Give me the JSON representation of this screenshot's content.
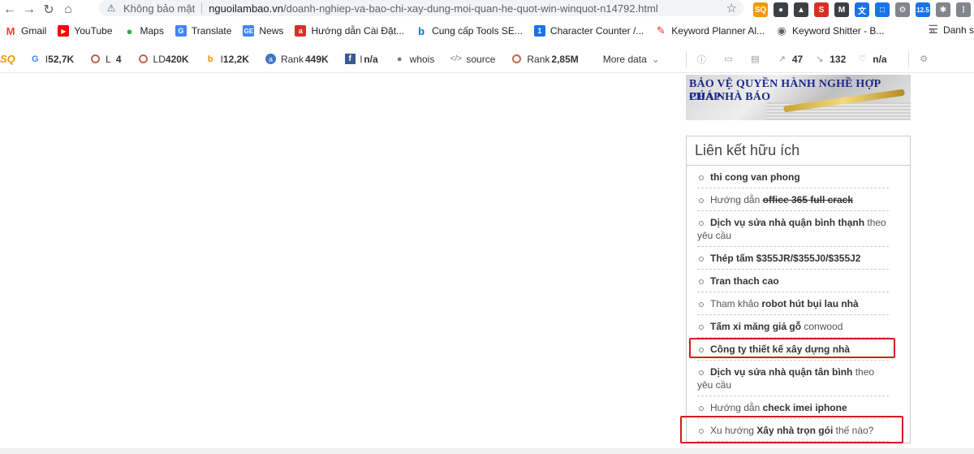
{
  "browser": {
    "security_label": "Không bảo mật",
    "url_domain": "nguoilambao.vn",
    "url_path": "/doanh-nghiep-va-bao-chi-xay-dung-moi-quan-he-quot-win-winquot-n14792.html",
    "extensions_badge": "12.5",
    "reading_list_label": "Danh s"
  },
  "bookmarks": [
    {
      "label": "Gmail",
      "icon": "gmail-icon",
      "color": "#ea4335"
    },
    {
      "label": "YouTube",
      "icon": "youtube-icon",
      "color": "#ff0000"
    },
    {
      "label": "Maps",
      "icon": "maps-icon",
      "color": "#34a853"
    },
    {
      "label": "Translate",
      "icon": "translate-icon",
      "color": "#4285f4"
    },
    {
      "label": "News",
      "icon": "news-icon",
      "color": "#4285f4"
    },
    {
      "label": "Hướng dẫn Cài Đặt...",
      "icon": "a-icon",
      "color": "#d93025"
    },
    {
      "label": "Cung cấp Tools SE...",
      "icon": "bing-icon",
      "color": "#0078d4"
    },
    {
      "label": "Character Counter /...",
      "icon": "one-icon",
      "color": "#1a73e8"
    },
    {
      "label": "Keyword Planner Al...",
      "icon": "keyword-icon",
      "color": "#d93025"
    },
    {
      "label": "Keyword Shitter - B...",
      "icon": "globe-icon",
      "color": "#5f6368"
    }
  ],
  "seo_toolbar": {
    "items": [
      {
        "icon": "google-icon",
        "prefix": "I",
        "value": "52,7K"
      },
      {
        "icon": "circle-icon",
        "prefix": "L",
        "value": "4"
      },
      {
        "icon": "circle-icon",
        "prefix": "LD",
        "value": "420K"
      },
      {
        "icon": "bing-icon",
        "prefix": "I",
        "value": "12,2K"
      },
      {
        "icon": "alexa-icon",
        "prefix": "Rank",
        "value": "449K"
      },
      {
        "icon": "facebook-icon",
        "prefix": "l",
        "value": "n/a"
      },
      {
        "icon": "user-icon",
        "prefix": "",
        "value": "whois"
      },
      {
        "icon": "code-icon",
        "prefix": "",
        "value": "source"
      },
      {
        "icon": "circle-icon",
        "prefix": "Rank",
        "value": "2,85M"
      }
    ],
    "more_label": "More data",
    "right_items": [
      {
        "icon": "external-link-icon",
        "value": "47"
      },
      {
        "icon": "internal-link-icon",
        "value": "132"
      },
      {
        "icon": "heart-icon",
        "value": "n/a"
      }
    ]
  },
  "banner": {
    "line1": "BẢO VỆ QUYỀN HÀNH NGHỀ HỢP PHÁP",
    "line2": "CỦA NHÀ BÁO"
  },
  "widget": {
    "title": "Liên kết hữu ích",
    "links": [
      {
        "pre": "",
        "bold": "thi cong van phong",
        "post": "",
        "strike": false
      },
      {
        "pre": "Hướng dẫn ",
        "bold": "office 365 full crack",
        "post": "",
        "strike": true
      },
      {
        "pre": "",
        "bold": "Dịch vụ sửa nhà quận bình thạnh",
        "post": " theo yêu cầu",
        "strike": false
      },
      {
        "pre": "",
        "bold": "Thép tấm $355JR/$355J0/$355J2",
        "post": "",
        "strike": false
      },
      {
        "pre": "",
        "bold": "Tran thach cao",
        "post": "",
        "strike": false
      },
      {
        "pre": "Tham khảo ",
        "bold": "robot hút bụi lau nhà",
        "post": "",
        "strike": false
      },
      {
        "pre": "",
        "bold": "Tấm xi măng giả gỗ",
        "post": " conwood",
        "strike": false
      },
      {
        "pre": "",
        "bold": "Công ty thiết kế xây dựng nhà",
        "post": "",
        "strike": false
      },
      {
        "pre": "",
        "bold": "Dịch vụ sửa nhà quận tân bình",
        "post": " theo yêu cầu",
        "strike": false
      },
      {
        "pre": "Hướng dẫn ",
        "bold": "check imei iphone",
        "post": "",
        "strike": false
      },
      {
        "pre": "Xu hướng ",
        "bold": "Xây nhà trọn gói",
        "post": " thế nào?",
        "strike": false
      }
    ]
  },
  "highlight_color": "#d61c1c"
}
